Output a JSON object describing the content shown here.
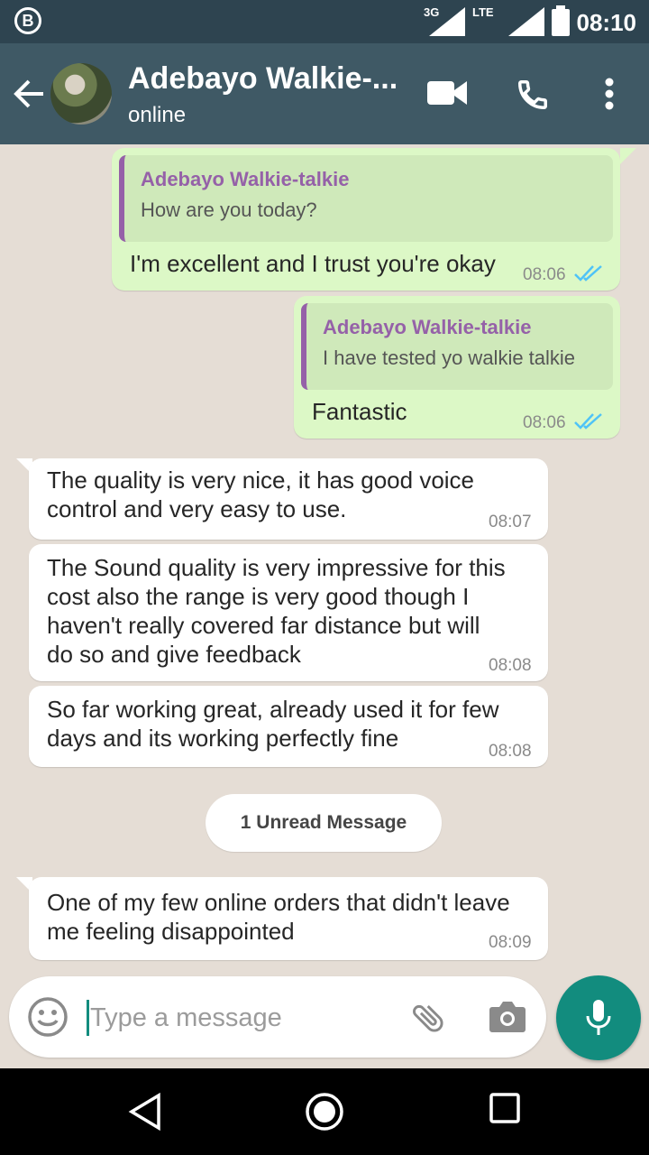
{
  "status_bar": {
    "network_3g": "3G",
    "network_lte": "LTE",
    "time": "08:10",
    "app_badge": "B"
  },
  "header": {
    "contact_name": "Adebayo Walkie-...",
    "status": "online"
  },
  "messages": [
    {
      "direction": "outgoing",
      "quoted_name": "Adebayo Walkie-talkie",
      "quoted_text": "How are you today?",
      "text": "I'm excellent and I trust you're okay",
      "time": "08:06"
    },
    {
      "direction": "outgoing",
      "quoted_name": "Adebayo Walkie-talkie",
      "quoted_text": "I have tested yo walkie talkie",
      "text": "Fantastic",
      "time": "08:06"
    },
    {
      "direction": "incoming",
      "lines": [
        "The quality is very nice, it has good voice",
        "control and very easy to use."
      ],
      "time": "08:07"
    },
    {
      "direction": "incoming",
      "lines": [
        "The Sound quality is very impressive for this",
        "cost also the range is very good though I",
        "haven't really covered far distance but will",
        "do so and give feedback"
      ],
      "time": "08:08"
    },
    {
      "direction": "incoming",
      "lines": [
        "So far working great, already used it for few",
        "days and its  working perfectly fine"
      ],
      "time": "08:08"
    },
    {
      "direction": "incoming",
      "lines": [
        "One of my few online orders that didn't leave",
        "me feeling disappointed"
      ],
      "time": "08:09"
    }
  ],
  "unread_banner": "1 Unread Message",
  "composer": {
    "placeholder": "Type a message"
  },
  "colors": {
    "header": "#3f5965",
    "status_bar": "#2e4450",
    "outgoing_bubble": "#dcf8c6",
    "incoming_bubble": "#ffffff",
    "accent": "#128c7e",
    "quote_name": "#9561a8",
    "read_ticks": "#4fc3f7"
  }
}
